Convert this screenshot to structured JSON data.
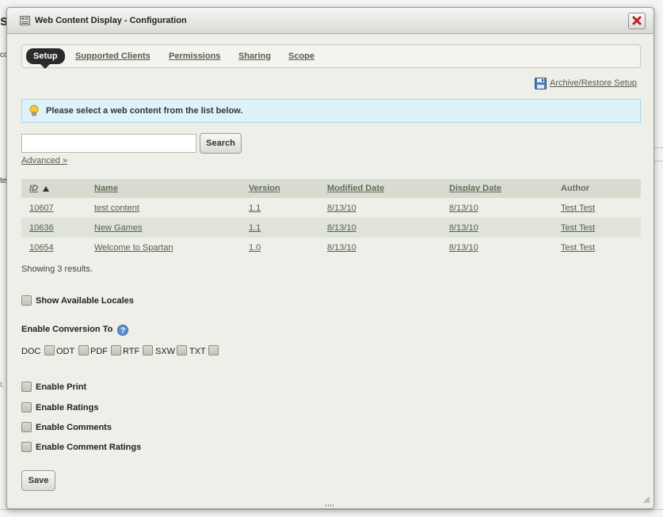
{
  "background": {
    "fragments": [
      "s",
      "cc",
      "te",
      "t."
    ]
  },
  "dialog": {
    "title": "Web Content Display - Configuration",
    "tabs": [
      "Setup",
      "Supported Clients",
      "Permissions",
      "Sharing",
      "Scope"
    ],
    "archive_link": "Archive/Restore Setup",
    "info_message": "Please select a web content from the list below.",
    "search": {
      "value": "",
      "button": "Search",
      "advanced": "Advanced »"
    },
    "table": {
      "headers": [
        "ID",
        "Name",
        "Version",
        "Modified Date",
        "Display Date",
        "Author"
      ],
      "rows": [
        [
          "10607",
          "test content",
          "1.1",
          "8/13/10",
          "8/13/10",
          "Test Test"
        ],
        [
          "10636",
          "New Games",
          "1.1",
          "8/13/10",
          "8/13/10",
          "Test Test"
        ],
        [
          "10654",
          "Welcome to Spartan",
          "1.0",
          "8/13/10",
          "8/13/10",
          "Test Test"
        ]
      ]
    },
    "showing": "Showing 3 results.",
    "show_locales": "Show Available Locales",
    "conversion": {
      "title": "Enable Conversion To",
      "formats": [
        "DOC",
        "ODT",
        "PDF",
        "RTF",
        "SXW",
        "TXT"
      ]
    },
    "options": [
      "Enable Print",
      "Enable Ratings",
      "Enable Comments",
      "Enable Comment Ratings"
    ],
    "save": "Save"
  },
  "colors": {
    "accent_link": "#53614a",
    "header_bg": "#d7dccf",
    "info_bg": "#def2fb"
  }
}
